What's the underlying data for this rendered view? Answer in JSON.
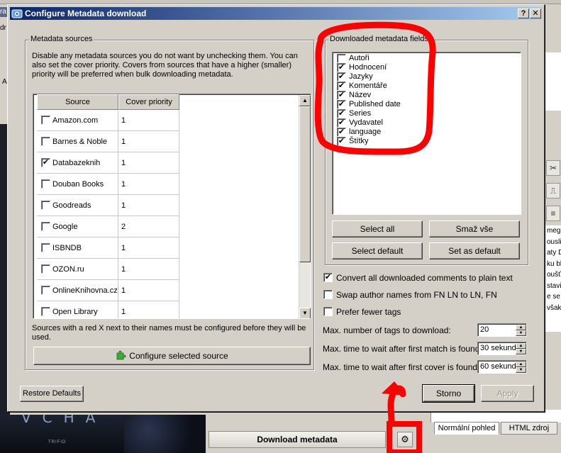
{
  "background": {
    "left_edge_labels": [
      "ra",
      "dr",
      "A"
    ],
    "right_text": "mega\nousli\naty D\nku bl\noušť\nstavi\ne se\nvšak",
    "cover_text": "VCHA",
    "cover_small": "TRIFID",
    "tabs": [
      "Normální pohled",
      "HTML zdroj"
    ],
    "download_button": "Download metadata"
  },
  "dialog": {
    "title": "Configure Metadata download",
    "help_btn": "?",
    "close_btn": "✕",
    "sources": {
      "group_title": "Metadata sources",
      "description": "Disable any metadata sources you do not want by unchecking them. You can also set the cover priority. Covers from sources that have a higher (smaller) priority will be preferred when bulk downloading metadata.",
      "columns": [
        "Source",
        "Cover priority"
      ],
      "rows": [
        {
          "name": "Amazon.com",
          "checked": false,
          "priority": "1"
        },
        {
          "name": "Barnes & Noble",
          "checked": false,
          "priority": "1"
        },
        {
          "name": "Databazeknih",
          "checked": true,
          "priority": "1"
        },
        {
          "name": "Douban Books",
          "checked": false,
          "priority": "1"
        },
        {
          "name": "Goodreads",
          "checked": false,
          "priority": "1"
        },
        {
          "name": "Google",
          "checked": false,
          "priority": "2"
        },
        {
          "name": "ISBNDB",
          "checked": false,
          "priority": "1"
        },
        {
          "name": "OZON.ru",
          "checked": false,
          "priority": "1"
        },
        {
          "name": "OnlineKnihovna.cz",
          "checked": false,
          "priority": "1"
        },
        {
          "name": "Open Library",
          "checked": false,
          "priority": "1"
        }
      ],
      "note": "Sources with a red X next to their names must be configured before they will be used.",
      "configure_button": "Configure selected source"
    },
    "fields": {
      "group_title": "Downloaded metadata fields",
      "items": [
        {
          "label": "Autoři",
          "checked": false
        },
        {
          "label": "Hodnocení",
          "checked": true
        },
        {
          "label": "Jazyky",
          "checked": true
        },
        {
          "label": "Komentáře",
          "checked": true
        },
        {
          "label": "Název",
          "checked": true
        },
        {
          "label": "Published date",
          "checked": true
        },
        {
          "label": "Series",
          "checked": true
        },
        {
          "label": "Vydavatel",
          "checked": true
        },
        {
          "label": "language",
          "checked": true
        },
        {
          "label": "Štítky",
          "checked": true
        }
      ],
      "select_all": "Select all",
      "clear_all": "Smaž vše",
      "select_default": "Select default",
      "set_default": "Set as default"
    },
    "options": [
      {
        "label": "Convert all downloaded comments to plain text",
        "checked": true
      },
      {
        "label": "Swap author names from FN LN to LN, FN",
        "checked": false
      },
      {
        "label": "Prefer fewer tags",
        "checked": false
      }
    ],
    "spins": [
      {
        "label": "Max. number of tags to download:",
        "value": "20"
      },
      {
        "label": "Max. time to wait after first match is found:",
        "value": "30 sekund"
      },
      {
        "label": "Max. time to wait after first cover is found:",
        "value": "60 sekund"
      }
    ],
    "restore_defaults": "Restore Defaults",
    "cancel": "Storno",
    "apply": "Apply"
  },
  "icons": {
    "title_icon": "plugin-icon",
    "configure_icon": "puzzle-piece-icon",
    "gear_icon": "gear-icon",
    "annotation_color": "#ff0000"
  }
}
